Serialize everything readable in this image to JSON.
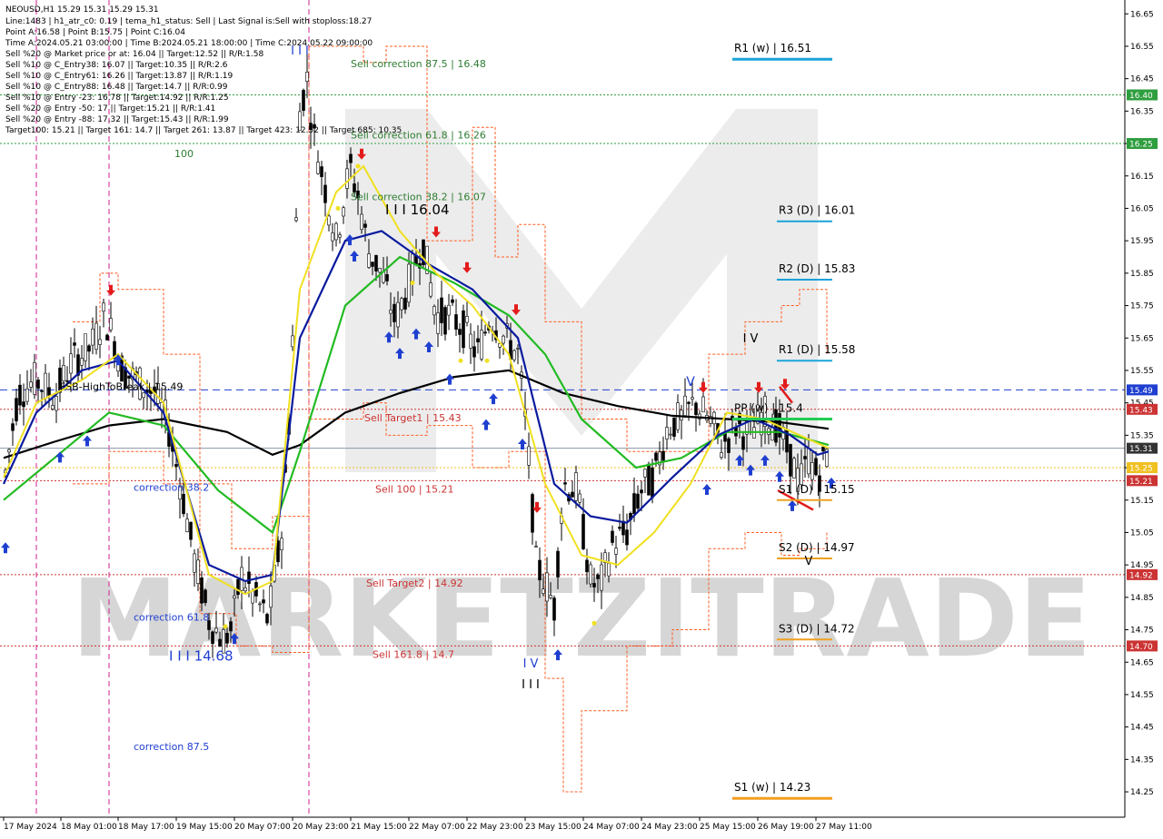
{
  "chart_data": {
    "type": "candlestick",
    "symbol_header": "NEOUSD,H1  15.29 15.31 15.29 15.31",
    "info_lines": [
      "Line:1483  | h1_atr_c0: 0.19  | tema_h1_status: Sell  | Last Signal is:Sell with stoploss:18.27",
      "Point A:16.58  | Point B:15.75  | Point C:16.04",
      "Time A:2024.05.21 03:00:00  | Time B:2024.05.21 18:00:00  | Time C:2024.05.22 09:00:00",
      "Sell %20 @ Market price or at: 16.04  || Target:12.52  || R/R:1.58",
      "Sell %10 @ C_Entry38: 16.07  || Target:10.35  || R/R:2.6",
      "Sell %10 @ C_Entry61: 16.26  || Target:13.87  || R/R:1.19",
      "Sell %10 @ C_Entry88: 16.48  || Target:14.7  || R/R:0.99",
      "Sell %10 @ Entry -23: 16.78  || Target:14.92  || R/R:1.25",
      "Sell %20 @ Entry -50: 17  || Target:15.21  || R/R:1.41",
      "Sell %20 @ Entry -88: 17.32  || Target:15.43  || R/R:1.99",
      "Target100: 15.21  || Target 161: 14.7  || Target 261: 13.87  || Target 423: 12.52  || Target 685: 10.35"
    ],
    "y_range": [
      14.2,
      16.7
    ],
    "y_ticks": [
      "16.65",
      "16.55",
      "16.45",
      "16.35",
      "16.25",
      "16.15",
      "16.05",
      "15.95",
      "15.85",
      "15.75",
      "15.65",
      "15.55",
      "15.45",
      "15.35",
      "15.25",
      "15.15",
      "15.05",
      "14.95",
      "14.85",
      "14.75",
      "14.65",
      "14.55",
      "14.45",
      "14.35",
      "14.25"
    ],
    "x_ticks": [
      "17 May 2024",
      "18 May 01:00",
      "18 May 17:00",
      "19 May 15:00",
      "20 May 07:00",
      "20 May 23:00",
      "21 May 15:00",
      "22 May 07:00",
      "22 May 23:00",
      "23 May 15:00",
      "24 May 07:00",
      "24 May 23:00",
      "25 May 15:00",
      "26 May 19:00",
      "27 May 11:00"
    ],
    "price_tags": [
      {
        "label": "16.40",
        "value": 16.4,
        "color": "#2e9e3e"
      },
      {
        "label": "16.25",
        "value": 16.25,
        "color": "#2e9e3e"
      },
      {
        "label": "15.49",
        "value": 15.49,
        "color": "#1f3fd0"
      },
      {
        "label": "15.43",
        "value": 15.43,
        "color": "#cc3333"
      },
      {
        "label": "15.31",
        "value": 15.31,
        "color": "#333333"
      },
      {
        "label": "15.25",
        "value": 15.25,
        "color": "#f0c020"
      },
      {
        "label": "15.21",
        "value": 15.21,
        "color": "#cc3333"
      },
      {
        "label": "14.92",
        "value": 14.92,
        "color": "#cc3333"
      },
      {
        "label": "14.70",
        "value": 14.7,
        "color": "#cc3333"
      }
    ],
    "horizontal_lines": [
      {
        "value": 16.4,
        "color": "#2e9e3e",
        "style": "dotted"
      },
      {
        "value": 16.25,
        "color": "#2e9e3e",
        "style": "dotted"
      },
      {
        "value": 15.49,
        "color": "#1f3fd0",
        "style": "dashed"
      },
      {
        "value": 15.43,
        "color": "#cc3333",
        "style": "dotted"
      },
      {
        "value": 15.31,
        "color": "#8898aa",
        "style": "solid"
      },
      {
        "value": 15.25,
        "color": "#f0c020",
        "style": "dotted"
      },
      {
        "value": 15.21,
        "color": "#cc3333",
        "style": "dotted"
      },
      {
        "value": 14.92,
        "color": "#cc3333",
        "style": "dotted"
      },
      {
        "value": 14.7,
        "color": "#cc3333",
        "style": "dotted"
      }
    ],
    "pivot_levels": [
      {
        "label": "R1 (w) | 16.51",
        "value": 16.51,
        "color": "#1aa3d9"
      },
      {
        "label": "R3 (D) | 16.01",
        "value": 16.01,
        "color": "#1aa3d9"
      },
      {
        "label": "R2 (D) | 15.83",
        "value": 15.83,
        "color": "#1aa3d9"
      },
      {
        "label": "R1 (D) | 15.58",
        "value": 15.58,
        "color": "#1aa3d9"
      },
      {
        "label": "PP (w) | 15.4",
        "value": 15.4,
        "color": "#22cc55"
      },
      {
        "label": "S1 (D) | 15.15",
        "value": 15.15,
        "color": "#f0a020"
      },
      {
        "label": "S2 (D) | 14.97",
        "value": 14.97,
        "color": "#f0a020"
      },
      {
        "label": "S3 (D) | 14.72",
        "value": 14.72,
        "color": "#f0a020"
      },
      {
        "label": "S1 (w) | 14.23",
        "value": 14.23,
        "color": "#f0a020"
      }
    ],
    "annotations": [
      {
        "text": "Sell correction 87.5 | 16.48",
        "value": 16.48,
        "color": "#2e7d32"
      },
      {
        "text": "Sell correction 61.8 | 16.26",
        "value": 16.26,
        "color": "#2e7d32"
      },
      {
        "text": "Sell correction 38.2 | 16.07",
        "value": 16.07,
        "color": "#2e7d32"
      },
      {
        "text": "Sell Target1 | 15.43",
        "value": 15.43,
        "color": "#cc3333"
      },
      {
        "text": "Sell 100 | 15.21",
        "value": 15.21,
        "color": "#cc3333"
      },
      {
        "text": "Sell Target2 | 14.92",
        "value": 14.92,
        "color": "#cc3333"
      },
      {
        "text": "Sell 161.8 | 14.7",
        "value": 14.7,
        "color": "#cc3333"
      },
      {
        "text": "I I I 16.04",
        "value": 16.04,
        "color": "#000000"
      },
      {
        "text": "I I I 14.68",
        "value": 14.68,
        "color": "#1f3fd0"
      },
      {
        "text": "correction 38.2",
        "value": 15.19,
        "color": "#1f3fd0"
      },
      {
        "text": "correction 61.8",
        "value": 14.79,
        "color": "#1f3fd0"
      },
      {
        "text": "correction 87.5",
        "value": 14.39,
        "color": "#1f3fd0"
      },
      {
        "text": "100",
        "value": 16.22,
        "color": "#2e7d32"
      },
      {
        "text": "FSB-HighToBreak | 15.49",
        "value": 15.49,
        "color": "#000000"
      }
    ],
    "series_legend": [
      {
        "color": "#000000"
      },
      {
        "color": "#0a1a9e"
      },
      {
        "color": "#f0e020"
      },
      {
        "color": "#22bb22"
      }
    ],
    "watermark": "MARKETZITRADE"
  }
}
